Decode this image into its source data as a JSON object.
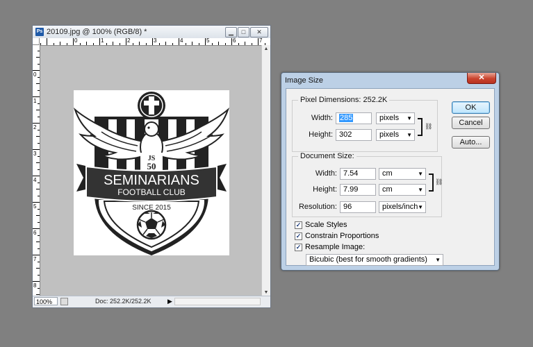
{
  "document_window": {
    "title": "20109.jpg @ 100% (RGB/8) *",
    "app_icon": "Ps",
    "buttons": {
      "minimize": "▁",
      "maximize": "□",
      "close": "✕"
    },
    "ruler_top_numbers": [
      "0",
      "1",
      "2",
      "3",
      "4",
      "5",
      "6",
      "7",
      "8"
    ],
    "ruler_left_numbers": [
      "0",
      "1",
      "2",
      "3",
      "4",
      "5",
      "6",
      "7",
      "8",
      "9"
    ],
    "status": {
      "zoom": "100%",
      "doc_info": "Doc: 252.2K/252.2K",
      "arrow": "▶"
    }
  },
  "logo": {
    "initials": "JS",
    "number": "50",
    "name": "SEMINARIANS",
    "subtitle": "FOOTBALL CLUB",
    "since": "SINCE 2015"
  },
  "dialog": {
    "title": "Image Size",
    "close_label": "✕",
    "pixel_dimensions": {
      "label": "Pixel Dimensions:",
      "size": "252.2K",
      "width_label": "Width:",
      "width_value": "285",
      "width_unit": "pixels",
      "height_label": "Height:",
      "height_value": "302",
      "height_unit": "pixels"
    },
    "document_size": {
      "label": "Document Size:",
      "width_label": "Width:",
      "width_value": "7.54",
      "width_unit": "cm",
      "height_label": "Height:",
      "height_value": "7.99",
      "height_unit": "cm",
      "resolution_label": "Resolution:",
      "resolution_value": "96",
      "resolution_unit": "pixels/inch"
    },
    "checkboxes": {
      "scale_styles": {
        "label": "Scale Styles",
        "checked": true
      },
      "constrain_proportions": {
        "label": "Constrain Proportions",
        "checked": true
      },
      "resample_image": {
        "label": "Resample Image:",
        "checked": true
      }
    },
    "resample_method": "Bicubic (best for smooth gradients)",
    "buttons": {
      "ok": "OK",
      "cancel": "Cancel",
      "auto": "Auto..."
    }
  }
}
